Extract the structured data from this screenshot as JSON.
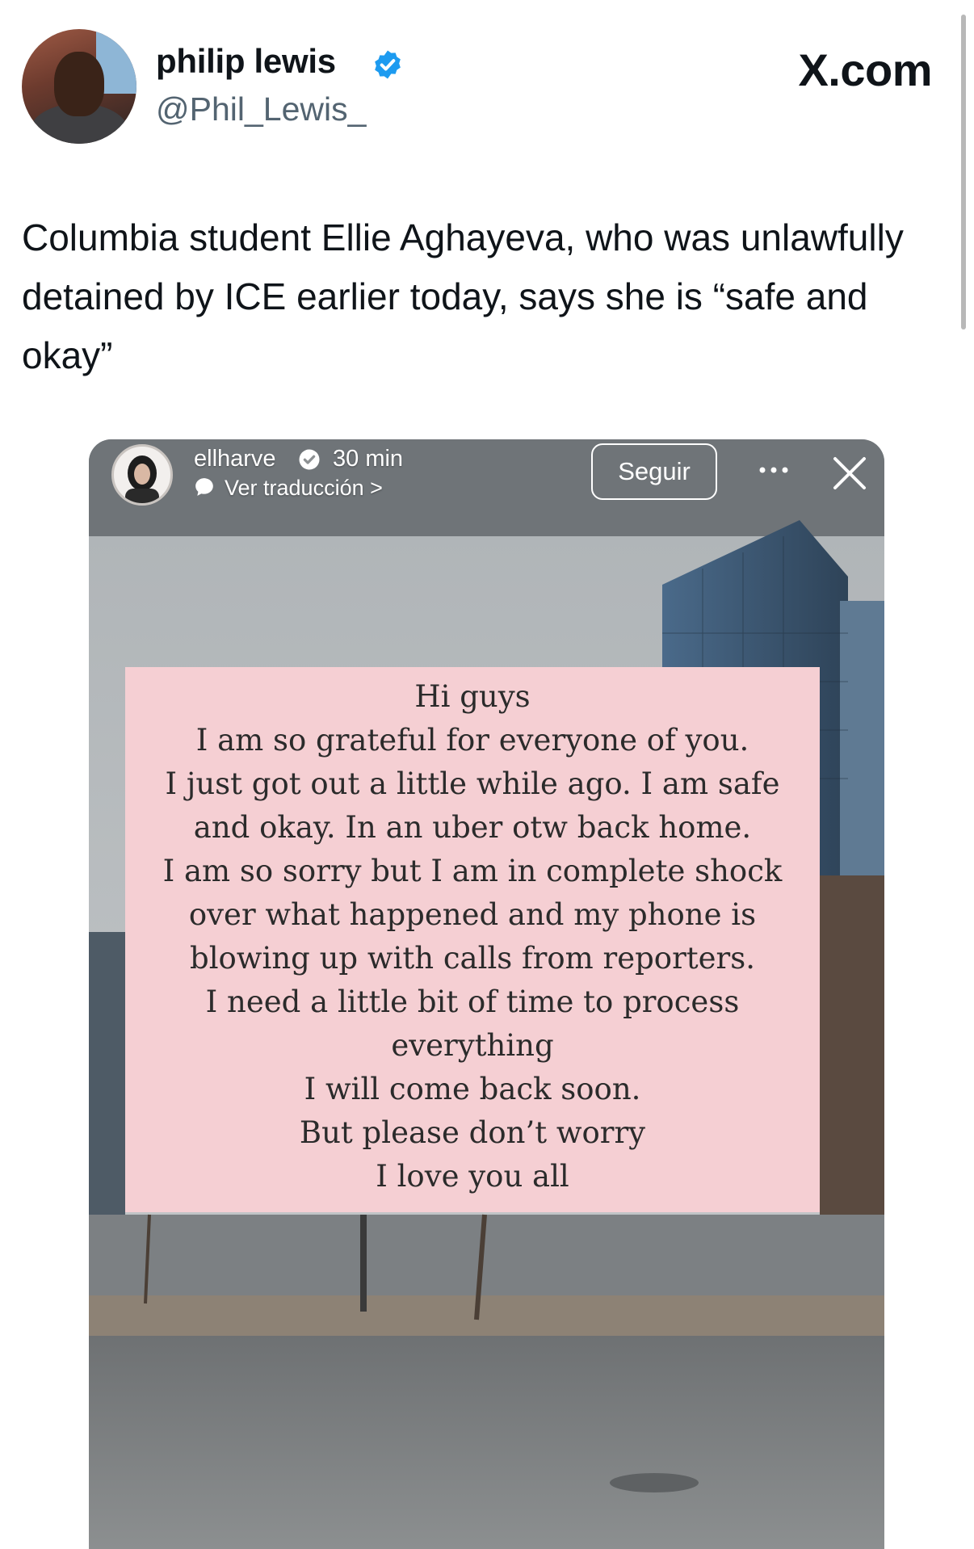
{
  "tweet": {
    "author_name": "philip lewis",
    "author_handle": "@Phil_Lewis_",
    "site": "X.com",
    "text": "Columbia student Ellie Aghayeva, who was unlawfully detained by ICE earlier today, says she is “safe and okay”",
    "verified_color": "#1d9bf0"
  },
  "story": {
    "username": "ellharve",
    "time": "30 min",
    "translate_label": "Ver traducción >",
    "follow_label": "Seguir",
    "note_bg": "#f5cfd3",
    "note_lines": [
      "Hi guys",
      "I am so grateful for everyone of you.",
      "I just got out a little while ago.  I am safe",
      "and okay. In an uber otw back home.",
      "I am so sorry but I am in complete shock",
      "over what happened and my phone is",
      "blowing up with calls from reporters.",
      "I need a little bit of time to process",
      "everything",
      "I will come back soon.",
      "But please don’t worry",
      "I love you all"
    ]
  },
  "icons": [
    "verified-badge-icon",
    "translate-icon",
    "more-dots-icon",
    "close-icon"
  ]
}
